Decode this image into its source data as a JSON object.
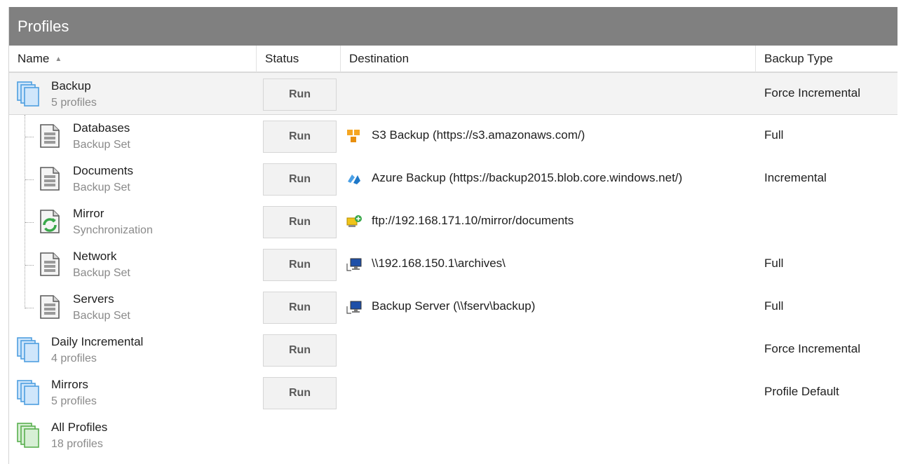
{
  "panel": {
    "title": "Profiles"
  },
  "columns": {
    "name": "Name",
    "status": "Status",
    "destination": "Destination",
    "backup_type": "Backup Type",
    "sort_indicator": "▲"
  },
  "rows": [
    {
      "name": "Backup",
      "sub": "5 profiles",
      "icon": "profile-group-icon",
      "run": "Run",
      "destination": "",
      "backup_type": "Force Incremental",
      "selected": true
    },
    {
      "name": "Databases",
      "sub": "Backup Set",
      "icon": "backup-set-icon",
      "run": "Run",
      "dest_icon": "amazon-s3-icon",
      "destination": "S3 Backup (https://s3.amazonaws.com/)",
      "backup_type": "Full"
    },
    {
      "name": "Documents",
      "sub": "Backup Set",
      "icon": "backup-set-icon",
      "run": "Run",
      "dest_icon": "azure-icon",
      "destination": "Azure Backup (https://backup2015.blob.core.windows.net/)",
      "backup_type": "Incremental"
    },
    {
      "name": "Mirror",
      "sub": "Synchronization",
      "icon": "sync-icon",
      "run": "Run",
      "dest_icon": "ftp-icon",
      "destination": "ftp://192.168.171.10/mirror/documents",
      "backup_type": ""
    },
    {
      "name": "Network",
      "sub": "Backup Set",
      "icon": "backup-set-icon",
      "run": "Run",
      "dest_icon": "network-computer-icon",
      "destination": "\\\\192.168.150.1\\archives\\",
      "backup_type": "Full"
    },
    {
      "name": "Servers",
      "sub": "Backup Set",
      "icon": "backup-set-icon",
      "run": "Run",
      "dest_icon": "network-computer-icon",
      "destination": "Backup Server (\\\\fserv\\backup)",
      "backup_type": "Full"
    },
    {
      "name": "Daily Incremental",
      "sub": "4 profiles",
      "icon": "profile-group-icon",
      "run": "Run",
      "destination": "",
      "backup_type": "Force Incremental"
    },
    {
      "name": "Mirrors",
      "sub": "5 profiles",
      "icon": "profile-group-icon",
      "run": "Run",
      "destination": "",
      "backup_type": "Profile Default"
    },
    {
      "name": "All Profiles",
      "sub": "18 profiles",
      "icon": "all-profiles-icon",
      "destination": "",
      "backup_type": ""
    }
  ],
  "colors": {
    "title_bar": "#808080",
    "selected_row": "#f3f3f3",
    "button_bg": "#f2f2f2",
    "group_icon_blue": "#4f9fe0",
    "sync_green": "#3aa84a"
  }
}
